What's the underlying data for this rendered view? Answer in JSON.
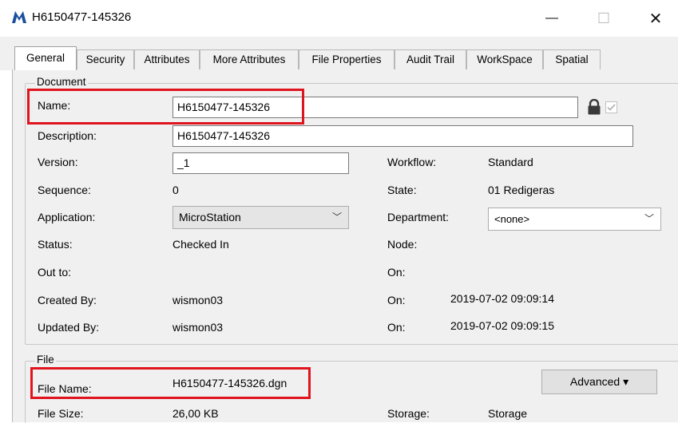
{
  "window": {
    "title": "H6150477-145326",
    "minimize_glyph": "—",
    "maximize_glyph": "☐",
    "close_glyph": "✕"
  },
  "tabs": [
    {
      "label": "General",
      "active": true
    },
    {
      "label": "Security"
    },
    {
      "label": "Attributes"
    },
    {
      "label": "More Attributes"
    },
    {
      "label": "File Properties"
    },
    {
      "label": "Audit Trail"
    },
    {
      "label": "WorkSpace"
    },
    {
      "label": "Spatial"
    }
  ],
  "document": {
    "group_title": "Document",
    "name_label": "Name:",
    "name_value": "H6150477-145326",
    "description_label": "Description:",
    "description_value": "H6150477-145326",
    "version_label": "Version:",
    "version_value": "_1",
    "sequence_label": "Sequence:",
    "sequence_value": "0",
    "application_label": "Application:",
    "application_value": "MicroStation",
    "status_label": "Status:",
    "status_value": "Checked In",
    "outto_label": "Out to:",
    "created_label": "Created By:",
    "created_value": "wismon03",
    "updated_label": "Updated By:",
    "updated_value": "wismon03",
    "workflow_label": "Workflow:",
    "workflow_value": "Standard",
    "state_label": "State:",
    "state_value": "01 Redigeras",
    "department_label": "Department:",
    "department_value": "<none>",
    "node_label": "Node:",
    "on_label": "On:",
    "created_on_value": "2019-07-02 09:09:14",
    "updated_on_value": "2019-07-02 09:09:15"
  },
  "file": {
    "group_title": "File",
    "filename_label": "File Name:",
    "filename_value": "H6150477-145326.dgn",
    "filesize_label": "File Size:",
    "filesize_value": "26,00 KB",
    "storage_label": "Storage:",
    "storage_value": "Storage",
    "advanced_label": "Advanced ▾"
  },
  "colors": {
    "highlight": "#e0141e",
    "panel": "#f0f0f0"
  }
}
